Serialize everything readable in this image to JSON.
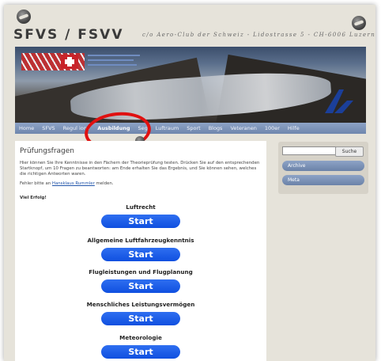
{
  "header": {
    "title": "SFVS / FSVV",
    "address": "c/o Aero-Club der Schweiz - Lidostrasse 5 - CH-6006 Luzern"
  },
  "nav": {
    "items": [
      "Home",
      "SFVS",
      "Regul",
      "ions",
      "Ausbildung",
      "Seg",
      "Luftraum",
      "Sport",
      "Blogs",
      "Veteranen",
      "100er",
      "Hilfe"
    ],
    "active": "Ausbildung"
  },
  "main": {
    "title": "Prüfungsfragen",
    "intro": "Hier können Sie Ihre Kenntnisse in den Fächern der Theorieprüfung testen. Drücken Sie auf den entsprechenden Startknopf, um 10 Fragen zu beantworten: am Ende erhalten Sie das Ergebnis, und Sie können sehen, welches die richtigen Antworten waren.",
    "errors_prefix": "Fehler bitte an",
    "errors_link": "Hansklaus Rummler",
    "errors_suffix": "melden.",
    "success": "Viel Erfolg!",
    "quizzes": [
      {
        "title": "Luftrecht",
        "button": "Start"
      },
      {
        "title": "Allgemeine Luftfahrzeugkenntnis",
        "button": "Start"
      },
      {
        "title": "Flugleistungen und Flugplanung",
        "button": "Start"
      },
      {
        "title": "Menschliches Leistungsvermögen",
        "button": "Start"
      },
      {
        "title": "Meteorologie",
        "button": "Start"
      }
    ]
  },
  "sidebar": {
    "search_value": "",
    "search_button": "Suche",
    "items": [
      "Archive",
      "Meta"
    ]
  },
  "colors": {
    "accent": "#7a91b8",
    "start_button": "#1a5be8",
    "annotation": "#e01010"
  }
}
